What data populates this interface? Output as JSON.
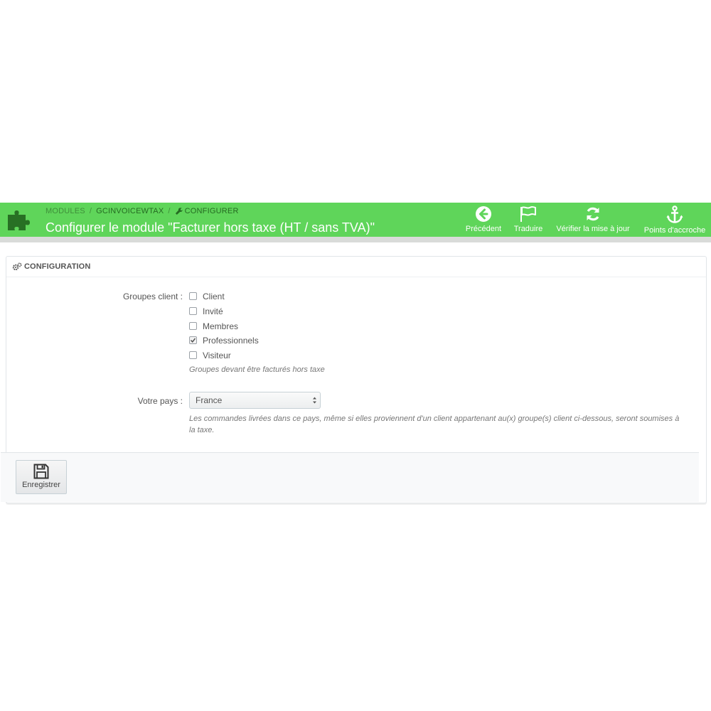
{
  "header": {
    "breadcrumb": [
      "MODULES",
      "GCINVOICEWTAX",
      "CONFIGURER"
    ],
    "title": "Configurer le module \"Facturer hors taxe (HT / sans TVA)\"",
    "toolbar": [
      {
        "label": "Précédent",
        "icon": "arrow-left-circle-icon"
      },
      {
        "label": "Traduire",
        "icon": "flag-icon"
      },
      {
        "label": "Vérifier la mise à jour",
        "icon": "refresh-icon"
      },
      {
        "label": "Points d'accroche",
        "icon": "anchor-icon"
      }
    ]
  },
  "panel": {
    "heading": "CONFIGURATION",
    "groups_label": "Groupes client :",
    "groups": [
      {
        "label": "Client",
        "checked": false
      },
      {
        "label": "Invité",
        "checked": false
      },
      {
        "label": "Membres",
        "checked": false
      },
      {
        "label": "Professionnels",
        "checked": true
      },
      {
        "label": "Visiteur",
        "checked": false
      }
    ],
    "groups_help": "Groupes devant être facturés hors taxe",
    "country_label": "Votre pays :",
    "country_value": "France",
    "country_help": "Les commandes livrées dans ce pays, même si elles proviennent d'un client appartenant au(x) groupe(s) client ci-dessous, seront soumises à la taxe.",
    "save_label": "Enregistrer"
  },
  "colors": {
    "header_green": "#5fd55a",
    "header_text": "#ffffff"
  }
}
